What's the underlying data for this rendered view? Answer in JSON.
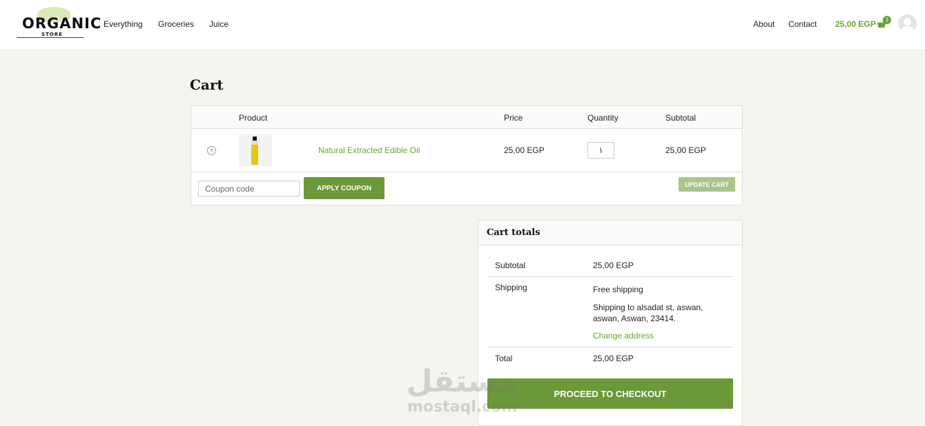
{
  "header": {
    "logo_text": "ORGANIC",
    "logo_sub": "STORE",
    "nav_left": [
      "Everything",
      "Groceries",
      "Juice"
    ],
    "nav_right": [
      "About",
      "Contact"
    ],
    "cart_amount": "25,00 EGP",
    "cart_count": "1"
  },
  "page": {
    "title": "Cart"
  },
  "cart_table": {
    "columns": [
      "Product",
      "Price",
      "Quantity",
      "Subtotal"
    ],
    "rows": [
      {
        "remove": "×",
        "name": "Natural Extracted Edible Oil",
        "price": "25,00 EGP",
        "quantity": "١",
        "subtotal": "25,00 EGP"
      }
    ],
    "coupon_placeholder": "Coupon code",
    "apply_label": "APPLY COUPON",
    "update_label": "UPDATE CART"
  },
  "totals": {
    "title": "Cart totals",
    "subtotal_label": "Subtotal",
    "subtotal_value": "25,00 EGP",
    "shipping_label": "Shipping",
    "shipping_method": "Free shipping",
    "shipping_to_prefix": "Shipping to",
    "shipping_address": "alsadat st, aswan, aswan, Aswan, 23414.",
    "change_address": "Change address",
    "total_label": "Total",
    "total_value": "25,00 EGP",
    "checkout_label": "PROCEED TO CHECKOUT"
  },
  "watermark": {
    "arabic": "مستقل",
    "latin": "mostaql.com"
  },
  "colors": {
    "accent": "#6aa334",
    "button": "#6b9838",
    "button_disabled": "#a9c58b",
    "background": "#f5f4f0"
  }
}
